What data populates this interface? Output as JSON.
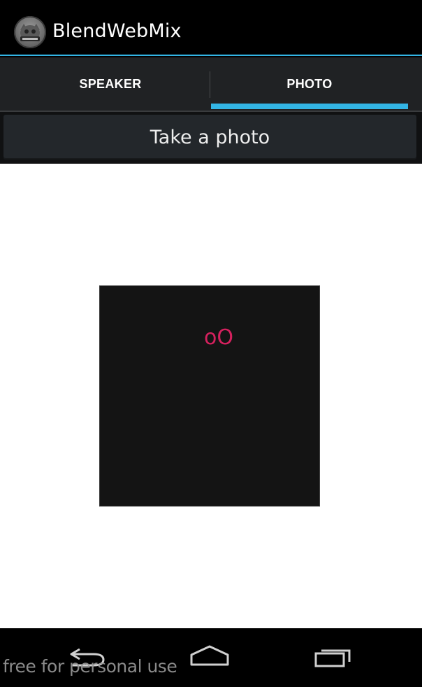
{
  "app": {
    "title": "BlendWebMix",
    "icon": "app-logo-icon",
    "accent_color": "#33b5e5"
  },
  "tabs": [
    {
      "label": "SPEAKER",
      "selected": false
    },
    {
      "label": "PHOTO",
      "selected": true
    }
  ],
  "actions": {
    "take_photo_label": "Take a photo"
  },
  "photo": {
    "placeholder_text": "oO",
    "text_color": "#d5215e"
  },
  "nav": {
    "back_icon": "back-icon",
    "home_icon": "home-icon",
    "recents_icon": "recents-icon"
  },
  "watermark": "free for personal use"
}
